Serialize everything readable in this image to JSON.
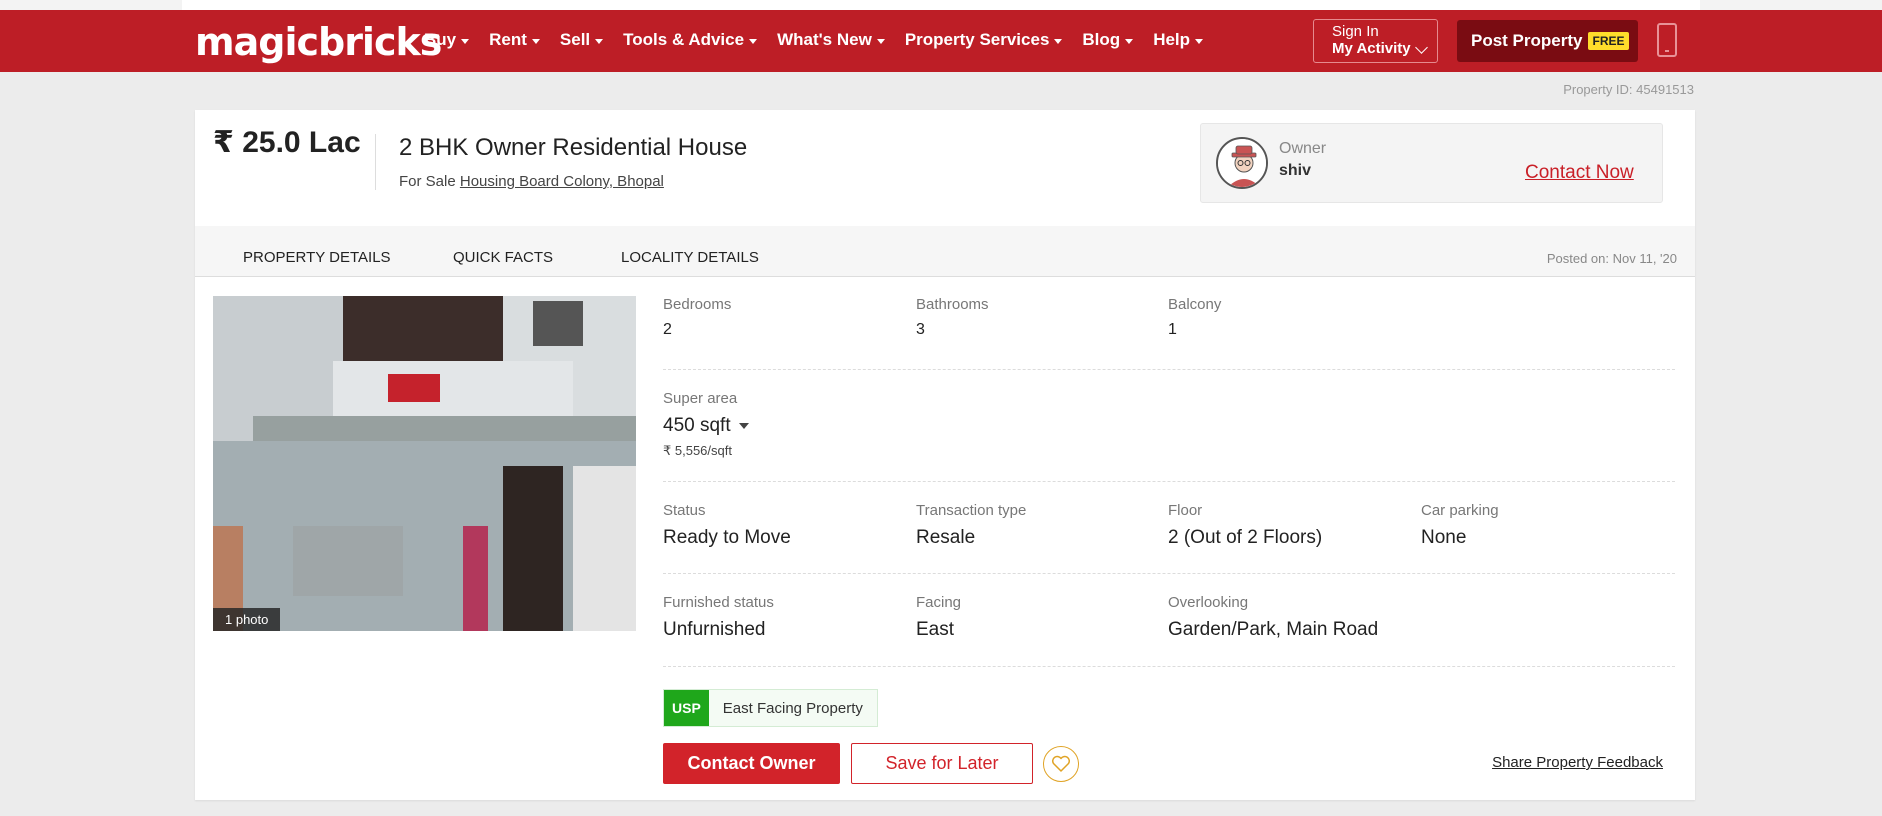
{
  "header": {
    "logo": "magicbricks",
    "nav": [
      "Buy",
      "Rent",
      "Sell",
      "Tools & Advice",
      "What's New",
      "Property Services",
      "Blog",
      "Help"
    ],
    "signin_line1": "Sign In",
    "signin_line2": "My Activity",
    "post_property": "Post Property",
    "post_badge": "FREE"
  },
  "property_id": "Property ID: 45491513",
  "summary": {
    "price": "₹ 25.0 Lac",
    "title": "2 BHK Owner Residential House",
    "for_sale": "For Sale",
    "location": "Housing Board Colony, Bhopal"
  },
  "owner": {
    "label": "Owner",
    "name": "shiv",
    "contact": "Contact Now"
  },
  "tabs": [
    "PROPERTY DETAILS",
    "QUICK FACTS",
    "LOCALITY DETAILS"
  ],
  "posted_on": "Posted on: Nov 11, '20",
  "photo_count": "1 photo",
  "details": {
    "bedrooms": {
      "label": "Bedrooms",
      "value": "2"
    },
    "bathrooms": {
      "label": "Bathrooms",
      "value": "3"
    },
    "balcony": {
      "label": "Balcony",
      "value": "1"
    },
    "super_area": {
      "label": "Super area",
      "value": "450 sqft",
      "rate": "₹ 5,556/sqft"
    },
    "status": {
      "label": "Status",
      "value": "Ready to Move"
    },
    "transaction": {
      "label": "Transaction type",
      "value": "Resale"
    },
    "floor": {
      "label": "Floor",
      "value": "2 (Out of 2 Floors)"
    },
    "parking": {
      "label": "Car parking",
      "value": "None"
    },
    "furnished": {
      "label": "Furnished status",
      "value": "Unfurnished"
    },
    "facing": {
      "label": "Facing",
      "value": "East"
    },
    "overlooking": {
      "label": "Overlooking",
      "value": "Garden/Park, Main Road"
    }
  },
  "usp": {
    "tag": "USP",
    "text": "East Facing Property"
  },
  "actions": {
    "contact_owner": "Contact Owner",
    "save_later": "Save for Later",
    "feedback": "Share Property Feedback"
  },
  "colors": {
    "brand": "#bd1e26",
    "usp": "#1fa71b",
    "accent": "#e0a325"
  }
}
